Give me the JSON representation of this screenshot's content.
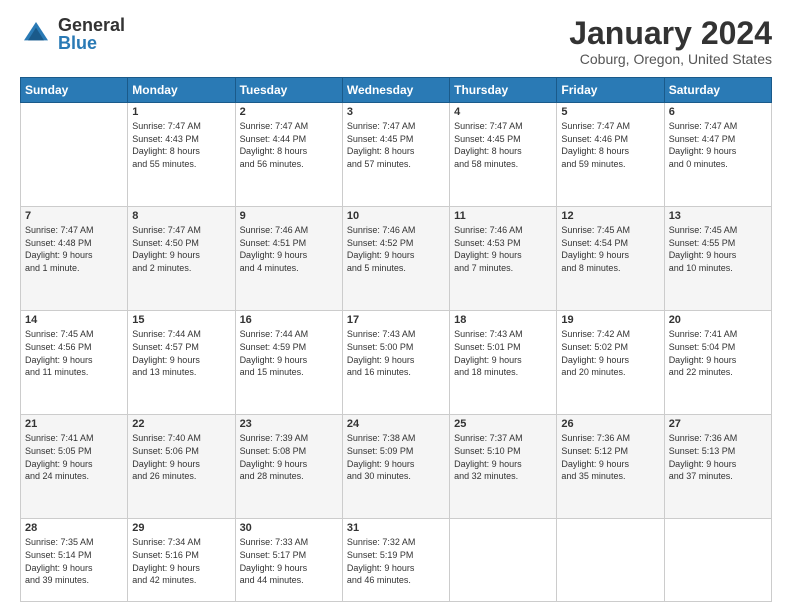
{
  "header": {
    "logo_general": "General",
    "logo_blue": "Blue",
    "month_year": "January 2024",
    "location": "Coburg, Oregon, United States"
  },
  "weekdays": [
    "Sunday",
    "Monday",
    "Tuesday",
    "Wednesday",
    "Thursday",
    "Friday",
    "Saturday"
  ],
  "weeks": [
    [
      {
        "day": "",
        "info": ""
      },
      {
        "day": "1",
        "info": "Sunrise: 7:47 AM\nSunset: 4:43 PM\nDaylight: 8 hours\nand 55 minutes."
      },
      {
        "day": "2",
        "info": "Sunrise: 7:47 AM\nSunset: 4:44 PM\nDaylight: 8 hours\nand 56 minutes."
      },
      {
        "day": "3",
        "info": "Sunrise: 7:47 AM\nSunset: 4:45 PM\nDaylight: 8 hours\nand 57 minutes."
      },
      {
        "day": "4",
        "info": "Sunrise: 7:47 AM\nSunset: 4:45 PM\nDaylight: 8 hours\nand 58 minutes."
      },
      {
        "day": "5",
        "info": "Sunrise: 7:47 AM\nSunset: 4:46 PM\nDaylight: 8 hours\nand 59 minutes."
      },
      {
        "day": "6",
        "info": "Sunrise: 7:47 AM\nSunset: 4:47 PM\nDaylight: 9 hours\nand 0 minutes."
      }
    ],
    [
      {
        "day": "7",
        "info": "Sunrise: 7:47 AM\nSunset: 4:48 PM\nDaylight: 9 hours\nand 1 minute."
      },
      {
        "day": "8",
        "info": "Sunrise: 7:47 AM\nSunset: 4:50 PM\nDaylight: 9 hours\nand 2 minutes."
      },
      {
        "day": "9",
        "info": "Sunrise: 7:46 AM\nSunset: 4:51 PM\nDaylight: 9 hours\nand 4 minutes."
      },
      {
        "day": "10",
        "info": "Sunrise: 7:46 AM\nSunset: 4:52 PM\nDaylight: 9 hours\nand 5 minutes."
      },
      {
        "day": "11",
        "info": "Sunrise: 7:46 AM\nSunset: 4:53 PM\nDaylight: 9 hours\nand 7 minutes."
      },
      {
        "day": "12",
        "info": "Sunrise: 7:45 AM\nSunset: 4:54 PM\nDaylight: 9 hours\nand 8 minutes."
      },
      {
        "day": "13",
        "info": "Sunrise: 7:45 AM\nSunset: 4:55 PM\nDaylight: 9 hours\nand 10 minutes."
      }
    ],
    [
      {
        "day": "14",
        "info": "Sunrise: 7:45 AM\nSunset: 4:56 PM\nDaylight: 9 hours\nand 11 minutes."
      },
      {
        "day": "15",
        "info": "Sunrise: 7:44 AM\nSunset: 4:57 PM\nDaylight: 9 hours\nand 13 minutes."
      },
      {
        "day": "16",
        "info": "Sunrise: 7:44 AM\nSunset: 4:59 PM\nDaylight: 9 hours\nand 15 minutes."
      },
      {
        "day": "17",
        "info": "Sunrise: 7:43 AM\nSunset: 5:00 PM\nDaylight: 9 hours\nand 16 minutes."
      },
      {
        "day": "18",
        "info": "Sunrise: 7:43 AM\nSunset: 5:01 PM\nDaylight: 9 hours\nand 18 minutes."
      },
      {
        "day": "19",
        "info": "Sunrise: 7:42 AM\nSunset: 5:02 PM\nDaylight: 9 hours\nand 20 minutes."
      },
      {
        "day": "20",
        "info": "Sunrise: 7:41 AM\nSunset: 5:04 PM\nDaylight: 9 hours\nand 22 minutes."
      }
    ],
    [
      {
        "day": "21",
        "info": "Sunrise: 7:41 AM\nSunset: 5:05 PM\nDaylight: 9 hours\nand 24 minutes."
      },
      {
        "day": "22",
        "info": "Sunrise: 7:40 AM\nSunset: 5:06 PM\nDaylight: 9 hours\nand 26 minutes."
      },
      {
        "day": "23",
        "info": "Sunrise: 7:39 AM\nSunset: 5:08 PM\nDaylight: 9 hours\nand 28 minutes."
      },
      {
        "day": "24",
        "info": "Sunrise: 7:38 AM\nSunset: 5:09 PM\nDaylight: 9 hours\nand 30 minutes."
      },
      {
        "day": "25",
        "info": "Sunrise: 7:37 AM\nSunset: 5:10 PM\nDaylight: 9 hours\nand 32 minutes."
      },
      {
        "day": "26",
        "info": "Sunrise: 7:36 AM\nSunset: 5:12 PM\nDaylight: 9 hours\nand 35 minutes."
      },
      {
        "day": "27",
        "info": "Sunrise: 7:36 AM\nSunset: 5:13 PM\nDaylight: 9 hours\nand 37 minutes."
      }
    ],
    [
      {
        "day": "28",
        "info": "Sunrise: 7:35 AM\nSunset: 5:14 PM\nDaylight: 9 hours\nand 39 minutes."
      },
      {
        "day": "29",
        "info": "Sunrise: 7:34 AM\nSunset: 5:16 PM\nDaylight: 9 hours\nand 42 minutes."
      },
      {
        "day": "30",
        "info": "Sunrise: 7:33 AM\nSunset: 5:17 PM\nDaylight: 9 hours\nand 44 minutes."
      },
      {
        "day": "31",
        "info": "Sunrise: 7:32 AM\nSunset: 5:19 PM\nDaylight: 9 hours\nand 46 minutes."
      },
      {
        "day": "",
        "info": ""
      },
      {
        "day": "",
        "info": ""
      },
      {
        "day": "",
        "info": ""
      }
    ]
  ]
}
